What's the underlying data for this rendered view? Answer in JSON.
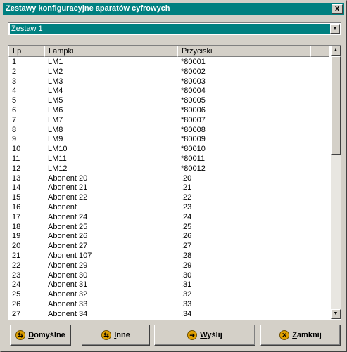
{
  "window": {
    "title": "Zestawy konfiguracyjne aparatów cyfrowych",
    "close_label": "X"
  },
  "combo": {
    "value": "Zestaw 1"
  },
  "table": {
    "headers": [
      "Lp",
      "Lampki",
      "Przyciski"
    ],
    "rows": [
      [
        "1",
        "LM1",
        "*80001"
      ],
      [
        "2",
        "LM2",
        "*80002"
      ],
      [
        "3",
        "LM3",
        "*80003"
      ],
      [
        "4",
        "LM4",
        "*80004"
      ],
      [
        "5",
        "LM5",
        "*80005"
      ],
      [
        "6",
        "LM6",
        "*80006"
      ],
      [
        "7",
        "LM7",
        "*80007"
      ],
      [
        "8",
        "LM8",
        "*80008"
      ],
      [
        "9",
        "LM9",
        "*80009"
      ],
      [
        "10",
        "LM10",
        "*80010"
      ],
      [
        "11",
        "LM11",
        "*80011"
      ],
      [
        "12",
        "LM12",
        "*80012"
      ],
      [
        "13",
        "Abonent 20",
        ",20"
      ],
      [
        "14",
        "Abonent 21",
        ",21"
      ],
      [
        "15",
        "Abonent 22",
        ",22"
      ],
      [
        "16",
        "Abonent",
        ",23"
      ],
      [
        "17",
        "Abonent 24",
        ",24"
      ],
      [
        "18",
        "Abonent 25",
        ",25"
      ],
      [
        "19",
        "Abonent 26",
        ",26"
      ],
      [
        "20",
        "Abonent 27",
        ",27"
      ],
      [
        "21",
        "Abonent 107",
        ",28"
      ],
      [
        "22",
        "Abonent 29",
        ",29"
      ],
      [
        "23",
        "Abonent 30",
        ",30"
      ],
      [
        "24",
        "Abonent 31",
        ",31"
      ],
      [
        "25",
        "Abonent 32",
        ",32"
      ],
      [
        "26",
        "Abonent 33",
        ",33"
      ],
      [
        "27",
        "Abonent 34",
        ",34"
      ]
    ]
  },
  "buttons": {
    "default": "Domyślne",
    "other": "Inne",
    "send": "Wyślij",
    "close": "Zamknij"
  },
  "icons": {
    "default": "arrows-icon",
    "other": "arrows-icon",
    "send": "arrow-right-icon",
    "close": "x-circle-icon"
  }
}
